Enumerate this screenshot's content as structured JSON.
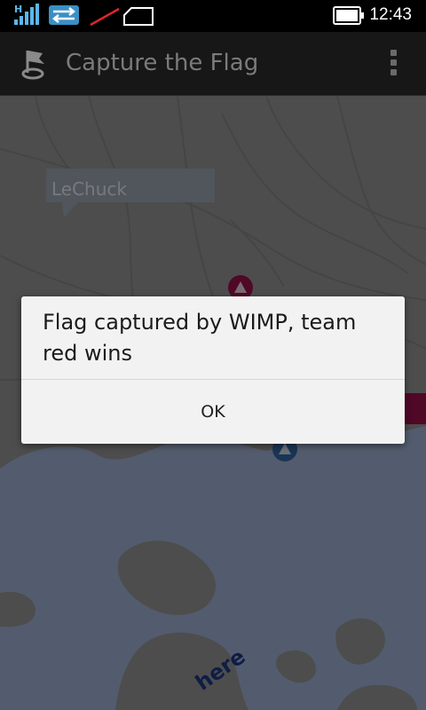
{
  "status_bar": {
    "network_type": "H",
    "time": "12:43",
    "icons": [
      "signal-icon",
      "data-transfer-icon",
      "no-sim-icon",
      "sim-card-icon",
      "battery-icon"
    ]
  },
  "action_bar": {
    "app_icon": "flag-icon",
    "title": "Capture the Flag",
    "menu_icon": "overflow-menu-icon"
  },
  "map": {
    "player_label": "LeChuck",
    "watermark": "here",
    "markers": [
      "red-team-marker",
      "blue-team-marker"
    ]
  },
  "dialog": {
    "message": "Flag captured by WIMP, team red wins",
    "ok_label": "OK"
  },
  "colors": {
    "land": "#9a9a9a",
    "water": "#a7b9dc",
    "red_team": "#a0104e",
    "blue_team": "#356aa8"
  }
}
